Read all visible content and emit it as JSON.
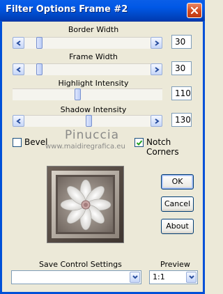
{
  "window": {
    "title": "Filter Options Frame #2"
  },
  "sliders": [
    {
      "label": "Border Width",
      "value": "30",
      "level": 0.1
    },
    {
      "label": "Frame Width",
      "value": "30",
      "level": 0.1
    },
    {
      "label": "Highlight Intensity",
      "value": "110",
      "level": 0.43
    },
    {
      "label": "Shadow Intensity",
      "value": "130",
      "level": 0.51
    }
  ],
  "options": {
    "bevel_label": "Bevel",
    "bevel_checked": false,
    "notch_label": "Notch Corners",
    "notch_checked": true
  },
  "watermark": {
    "line1": "Pinuccia",
    "line2": "www.maidiregrafica.eu"
  },
  "buttons": {
    "ok": "OK",
    "cancel": "Cancel",
    "about": "About"
  },
  "bottom": {
    "save_label": "Save Control Settings",
    "save_value": "",
    "preview_label": "Preview",
    "preview_value": "1:1"
  }
}
